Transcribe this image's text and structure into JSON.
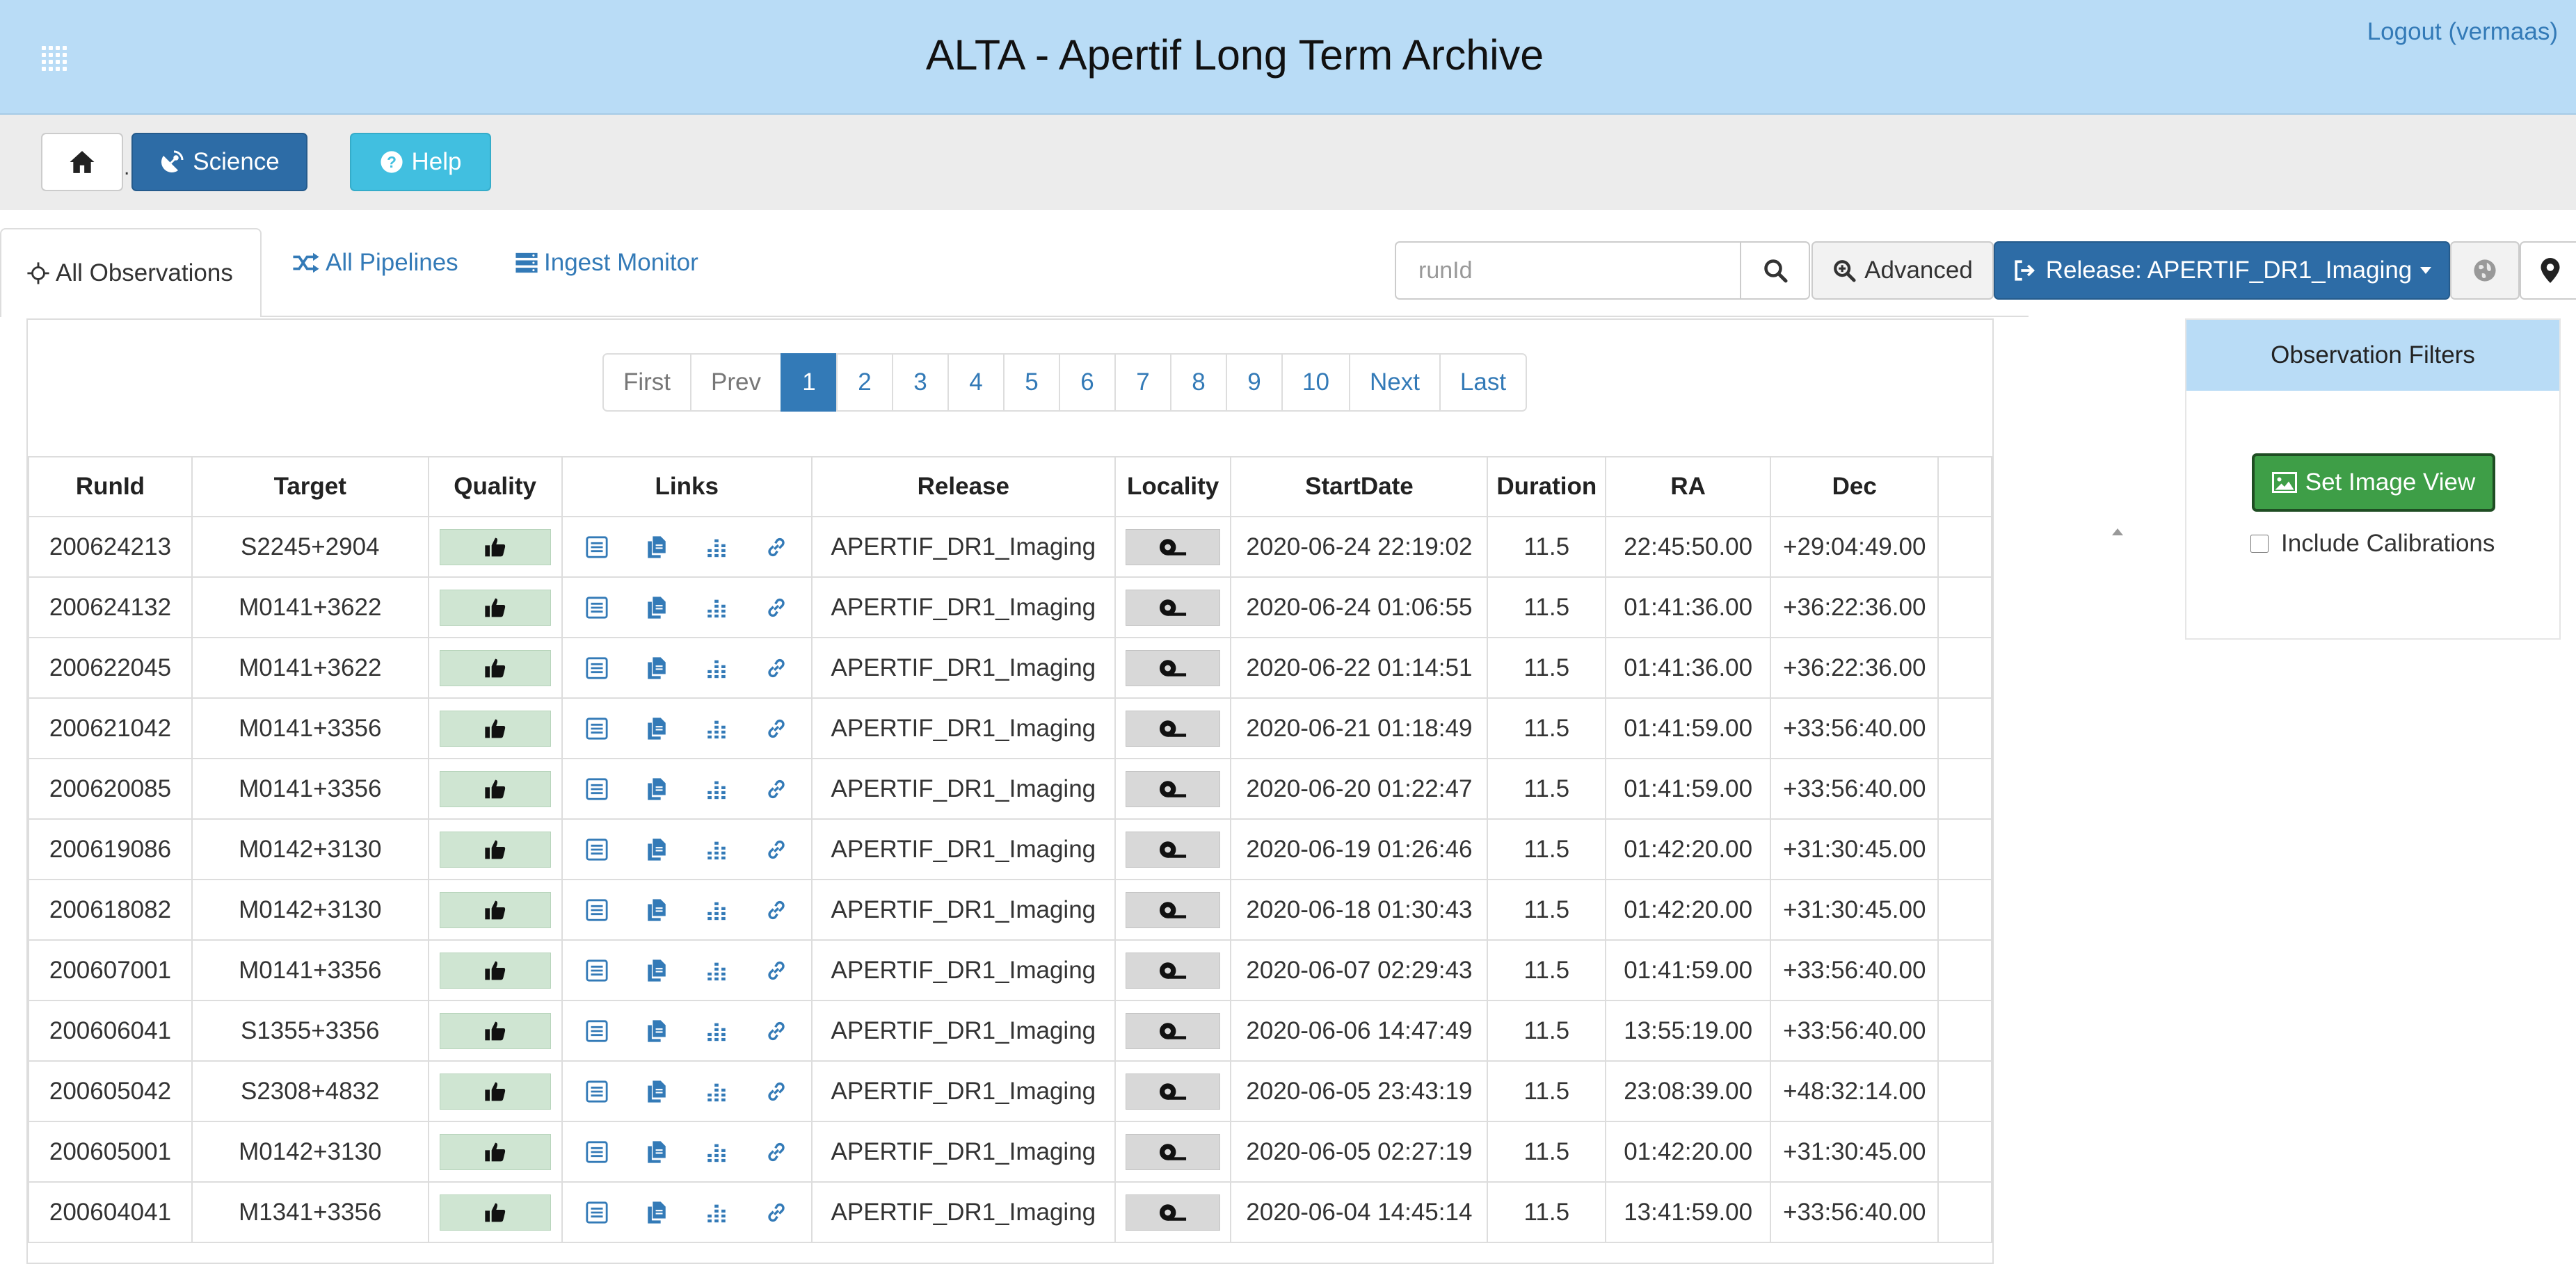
{
  "header": {
    "title": "ALTA - Apertif Long Term Archive",
    "logout": "Logout (vermaas)",
    "menu_icon": "grid-dots-icon"
  },
  "toolbar": {
    "home_icon": "home-icon",
    "science_label": "Science",
    "help_label": "Help"
  },
  "tabs": [
    {
      "label": "All Observations",
      "icon": "crosshair-icon",
      "active": true
    },
    {
      "label": "All Pipelines",
      "icon": "shuffle-icon",
      "active": false
    },
    {
      "label": "Ingest Monitor",
      "icon": "server-icon",
      "active": false
    }
  ],
  "search": {
    "placeholder": "runId",
    "advanced_label": "Advanced",
    "release_label": "Release: APERTIF_DR1_Imaging"
  },
  "pagination": [
    "First",
    "Prev",
    "1",
    "2",
    "3",
    "4",
    "5",
    "6",
    "7",
    "8",
    "9",
    "10",
    "Next",
    "Last"
  ],
  "table": {
    "columns": [
      "RunId",
      "Target",
      "Quality",
      "Links",
      "Release",
      "Locality",
      "StartDate",
      "Duration",
      "RA",
      "Dec"
    ],
    "rows": [
      [
        "200624213",
        "S2245+2904",
        "APERTIF_DR1_Imaging",
        "2020-06-24 22:19:02",
        "11.5",
        "22:45:50.00",
        "+29:04:49.00"
      ],
      [
        "200624132",
        "M0141+3622",
        "APERTIF_DR1_Imaging",
        "2020-06-24 01:06:55",
        "11.5",
        "01:41:36.00",
        "+36:22:36.00"
      ],
      [
        "200622045",
        "M0141+3622",
        "APERTIF_DR1_Imaging",
        "2020-06-22 01:14:51",
        "11.5",
        "01:41:36.00",
        "+36:22:36.00"
      ],
      [
        "200621042",
        "M0141+3356",
        "APERTIF_DR1_Imaging",
        "2020-06-21 01:18:49",
        "11.5",
        "01:41:59.00",
        "+33:56:40.00"
      ],
      [
        "200620085",
        "M0141+3356",
        "APERTIF_DR1_Imaging",
        "2020-06-20 01:22:47",
        "11.5",
        "01:41:59.00",
        "+33:56:40.00"
      ],
      [
        "200619086",
        "M0142+3130",
        "APERTIF_DR1_Imaging",
        "2020-06-19 01:26:46",
        "11.5",
        "01:42:20.00",
        "+31:30:45.00"
      ],
      [
        "200618082",
        "M0142+3130",
        "APERTIF_DR1_Imaging",
        "2020-06-18 01:30:43",
        "11.5",
        "01:42:20.00",
        "+31:30:45.00"
      ],
      [
        "200607001",
        "M0141+3356",
        "APERTIF_DR1_Imaging",
        "2020-06-07 02:29:43",
        "11.5",
        "01:41:59.00",
        "+33:56:40.00"
      ],
      [
        "200606041",
        "S1355+3356",
        "APERTIF_DR1_Imaging",
        "2020-06-06 14:47:49",
        "11.5",
        "13:55:19.00",
        "+33:56:40.00"
      ],
      [
        "200605042",
        "S2308+4832",
        "APERTIF_DR1_Imaging",
        "2020-06-05 23:43:19",
        "11.5",
        "23:08:39.00",
        "+48:32:14.00"
      ],
      [
        "200605001",
        "M0142+3130",
        "APERTIF_DR1_Imaging",
        "2020-06-05 02:27:19",
        "11.5",
        "01:42:20.00",
        "+31:30:45.00"
      ],
      [
        "200604041",
        "M1341+3356",
        "APERTIF_DR1_Imaging",
        "2020-06-04 14:45:14",
        "11.5",
        "13:41:59.00",
        "+33:56:40.00"
      ]
    ]
  },
  "filters": {
    "title": "Observation Filters",
    "set_view_label": "Set Image View",
    "include_calibrations_label": "Include Calibrations"
  },
  "colors": {
    "header_bg": "#b9dcf6",
    "primary": "#2d6ca6",
    "link": "#337ab7",
    "help": "#41bfe0",
    "success": "#3e9e47"
  }
}
